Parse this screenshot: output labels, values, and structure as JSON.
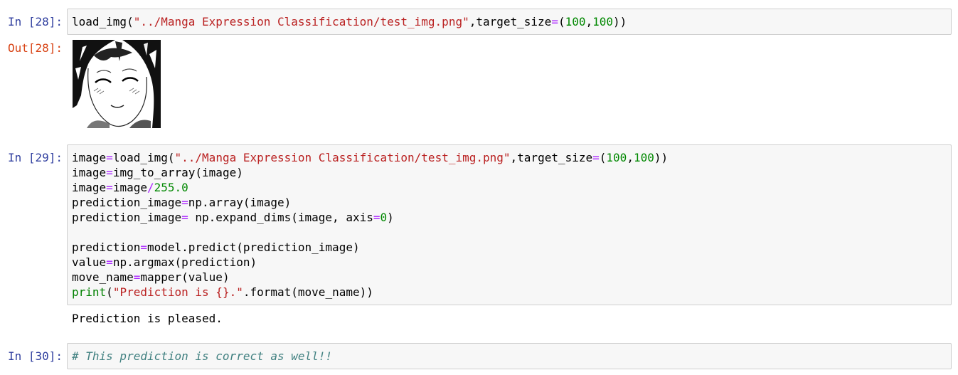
{
  "cells": [
    {
      "in_prompt": "In [28]:",
      "out_prompt": "Out[28]:",
      "code": {
        "fn": "load_img(",
        "path": "\"../Manga Expression Classification/test_img.png\"",
        "kw": ",target_size",
        "eq": "=",
        "open": "(",
        "n1": "100",
        "comma": ",",
        "n2": "100",
        "close": "))"
      },
      "output_image": "manga-face-image"
    },
    {
      "in_prompt": "In [29]:",
      "lines": {
        "l1": {
          "a": "image",
          "eq": "=",
          "b": "load_img(",
          "s": "\"../Manga Expression Classification/test_img.png\"",
          "c": ",target_size",
          "eq2": "=",
          "d": "(",
          "n1": "100",
          "e": ",",
          "n2": "100",
          "f": "))"
        },
        "l2": {
          "a": "image",
          "eq": "=",
          "b": "img_to_array(image)"
        },
        "l3": {
          "a": "image",
          "eq": "=",
          "b": "image",
          "op": "/",
          "n": "255.0"
        },
        "l4": {
          "a": "prediction_image",
          "eq": "=",
          "b": "np.array(image)"
        },
        "l5": {
          "a": "prediction_image",
          "eq": "=",
          "b": " np.expand_dims(image, axis",
          "eq2": "=",
          "n": "0",
          "c": ")"
        },
        "l7": {
          "a": "prediction",
          "eq": "=",
          "b": "model.predict(prediction_image)"
        },
        "l8": {
          "a": "value",
          "eq": "=",
          "b": "np.argmax(prediction)"
        },
        "l9": {
          "a": "move_name",
          "eq": "=",
          "b": "mapper(value)"
        },
        "l10": {
          "kw": "print",
          "a": "(",
          "s": "\"Prediction is {}.\"",
          "b": ".format(move_name))"
        }
      },
      "stdout": "Prediction is pleased."
    },
    {
      "in_prompt": "In [30]:",
      "comment": "# This prediction is correct as well!!"
    }
  ],
  "colors": {
    "in_prompt": "#303f9f",
    "out_prompt": "#d84315",
    "string": "#ba2121",
    "number": "#008800",
    "operator": "#aa22ff",
    "builtin": "#008000",
    "comment": "#408080",
    "cell_bg": "#f7f7f7",
    "cell_border": "#cfcfcf"
  }
}
